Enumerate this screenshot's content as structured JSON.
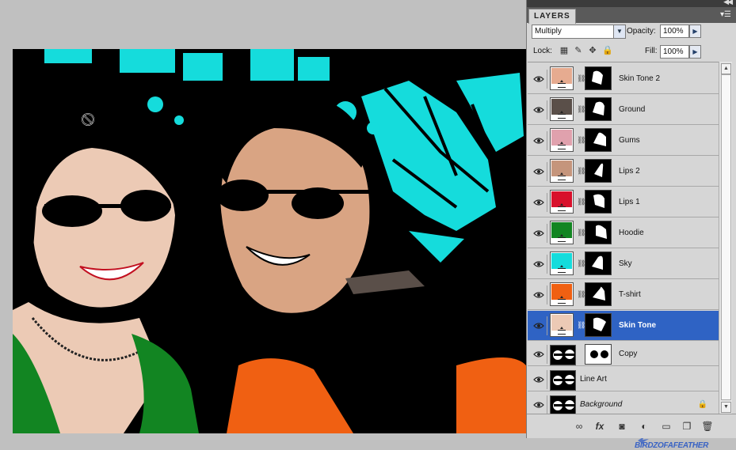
{
  "panel": {
    "tab_label": "LAYERS",
    "blend_mode": "Multiply",
    "opacity_label": "Opacity:",
    "opacity_value": "100%",
    "lock_label": "Lock:",
    "fill_label": "Fill:",
    "fill_value": "100%"
  },
  "layers": [
    {
      "name": "Skin Tone 2",
      "color": "#e6ab90",
      "selected": false
    },
    {
      "name": "Ground",
      "color": "#5a4f49",
      "selected": false
    },
    {
      "name": "Gums",
      "color": "#e0a1ad",
      "selected": false
    },
    {
      "name": "Lips 2",
      "color": "#c5957c",
      "selected": false
    },
    {
      "name": "Lips 1",
      "color": "#d8102b",
      "selected": false
    },
    {
      "name": "Hoodie",
      "color": "#128522",
      "selected": false
    },
    {
      "name": "Sky",
      "color": "#15dcdc",
      "selected": false
    },
    {
      "name": "T-shirt",
      "color": "#f06012",
      "selected": false
    },
    {
      "name": "Skin Tone",
      "color": "#eccab5",
      "selected": true
    },
    {
      "name": "Copy",
      "selected": false
    },
    {
      "name": "Line Art",
      "selected": false
    },
    {
      "name": "Background",
      "selected": false
    }
  ],
  "watermark": "BIRDZOFAFEATHER",
  "colors": {
    "selection": "#2f63c4",
    "panel_bg": "#d6d6d6",
    "canvas_bg": "#c0c0c0"
  },
  "icons": [
    "eye-icon",
    "link-icon",
    "lock-icon",
    "fx-icon",
    "mask-icon",
    "adjustment-icon",
    "folder-icon",
    "new-layer-icon",
    "trash-icon"
  ]
}
